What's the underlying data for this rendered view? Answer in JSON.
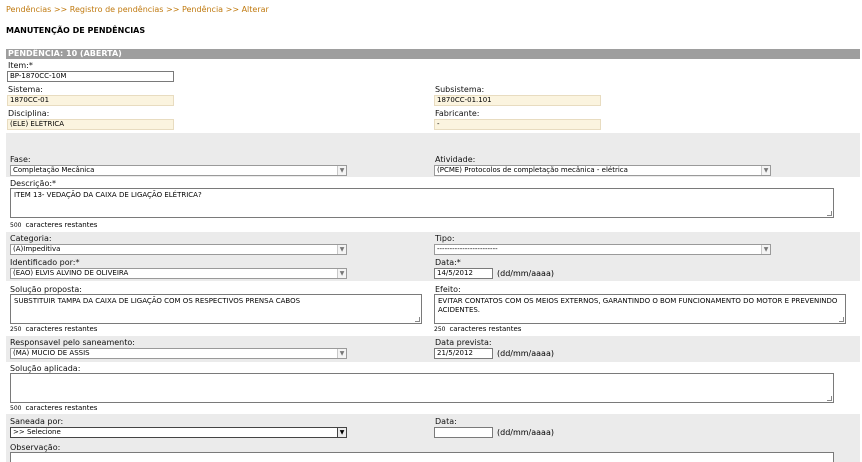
{
  "breadcrumb": [
    "Pendências",
    "Registro de pendências",
    "Pendência",
    "Alterar"
  ],
  "breadcrumb_sep": ">>",
  "page_title": "MANUTENÇÃO DE PENDÊNCIAS",
  "section_header": "PENDÊNCIA: 10 (ABERTA)",
  "item": {
    "label": "Item:*",
    "value": "BP-1870CC-10M"
  },
  "sistema": {
    "label": "Sistema:",
    "value": "1870CC-01"
  },
  "subsistema": {
    "label": "Subsistema:",
    "value": "1870CC-01.101"
  },
  "disciplina": {
    "label": "Disciplina:",
    "value": "(ELE) ELÉTRICA"
  },
  "fabricante": {
    "label": "Fabricante:",
    "value": "-"
  },
  "fase": {
    "label": "Fase:",
    "value": "Completação Mecânica"
  },
  "atividade": {
    "label": "Atividade:",
    "value": "(PCME) Protocolos de completação mecânica - elétrica"
  },
  "descricao": {
    "label": "Descrição:*",
    "value": "ITEM 13- VEDAÇÃO DA CAIXA DE LIGAÇÃO ELÉTRICA?",
    "remaining": "500",
    "remaining_text": "caracteres restantes"
  },
  "categoria": {
    "label": "Categoria:",
    "value": "(A)Impeditiva"
  },
  "tipo": {
    "label": "Tipo:",
    "value": "------------------------"
  },
  "identificado": {
    "label": "Identificado por:*",
    "value": "(EAO) ELVIS ALVINO DE OLIVEIRA"
  },
  "data1": {
    "label": "Data:*",
    "value": "14/5/2012",
    "hint": "(dd/mm/aaaa)"
  },
  "solucao_proposta": {
    "label": "Solução proposta:",
    "value": "SUBSTITUIR TAMPA DA CAIXA DE LIGAÇÃO COM OS RESPECTIVOS PRENSA CABOS",
    "remaining": "250",
    "remaining_text": "caracteres restantes"
  },
  "efeito": {
    "label": "Efeito:",
    "value": "EVITAR CONTATOS COM OS MEIOS EXTERNOS, GARANTINDO O BOM FUNCIONAMENTO DO MOTOR E PREVENINDO ACIDENTES.",
    "remaining": "250",
    "remaining_text": "caracteres restantes"
  },
  "responsavel": {
    "label": "Responsavel pelo saneamento:",
    "value": "(MA) MUCIO DE ASSIS"
  },
  "data_prevista": {
    "label": "Data prevista:",
    "value": "21/5/2012",
    "hint": "(dd/mm/aaaa)"
  },
  "solucao_aplicada": {
    "label": "Solução aplicada:",
    "value": "",
    "remaining": "500",
    "remaining_text": "caracteres restantes"
  },
  "saneada": {
    "label": "Saneada por:",
    "value": ">> Selecione"
  },
  "data2": {
    "label": "Data:",
    "value": "",
    "hint": "(dd/mm/aaaa)"
  },
  "observacao": {
    "label": "Observação:"
  },
  "icons": {
    "dropdown": "chevron-down-icon",
    "resize": "resize-grip-icon"
  }
}
